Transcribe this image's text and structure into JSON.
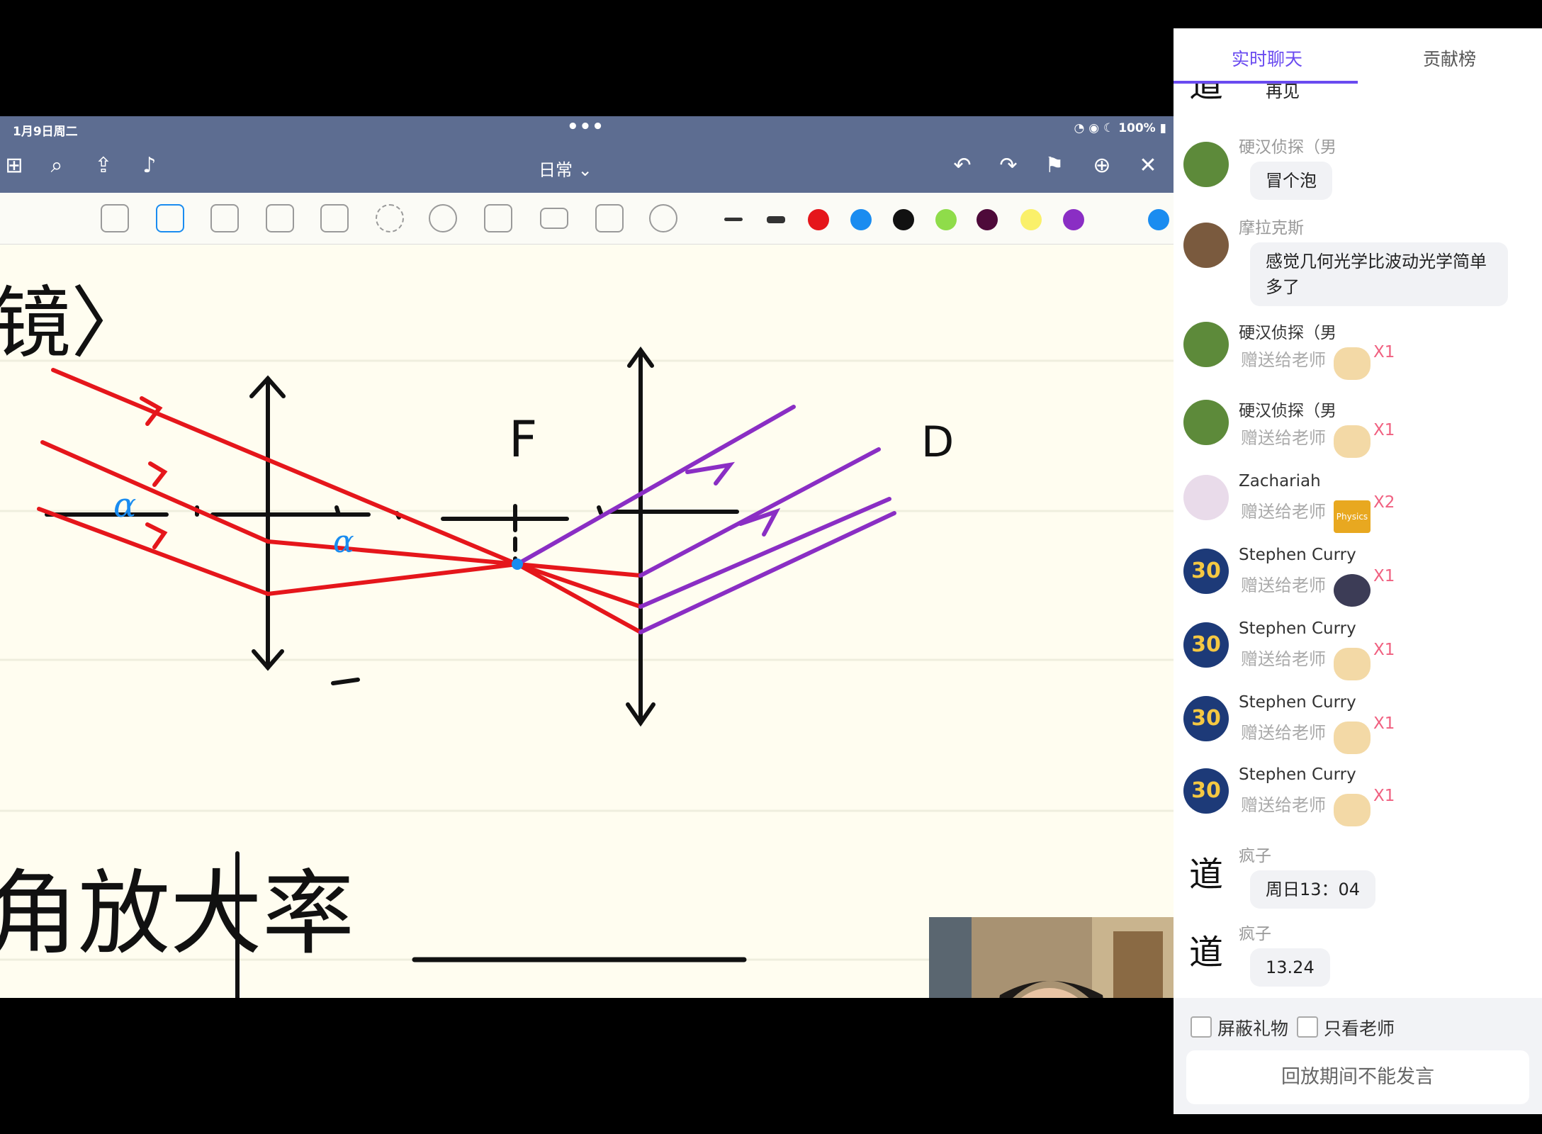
{
  "ipad": {
    "status_date": "1月9日周二",
    "status_dots": "•••",
    "status_right": "100%",
    "doc_title": "日常 ⌄"
  },
  "icons": {
    "grid": "grid-icon",
    "search": "search-icon",
    "share": "share-icon",
    "mic": "microphone-icon",
    "undo": "undo-icon",
    "redo": "redo-icon",
    "bookmark": "bookmark-icon",
    "add_page": "add-page-icon",
    "close": "close-icon"
  },
  "pen_colors": [
    "#e5161b",
    "#1a8cf0",
    "#111111",
    "#8fdc4a",
    "#4e0a3a",
    "#faf06a",
    "#8a2ec4",
    "#1a8cf0"
  ],
  "board": {
    "heading_partial": "镜〉",
    "label_F": "F",
    "label_D": "D",
    "label_alpha1": "α",
    "label_alpha2": "α",
    "bottom_text": "角放大率",
    "bottom_dash": "—"
  },
  "chat": {
    "tabs": [
      "实时聊天",
      "贡献榜"
    ],
    "messages": [
      {
        "type": "text",
        "name": "",
        "text": "再见"
      },
      {
        "type": "text",
        "name": "硬汉侦探（男",
        "text": "冒个泡"
      },
      {
        "type": "text",
        "name": "摩拉克斯",
        "text": "感觉几何光学比波动光学简单多了"
      },
      {
        "type": "gift",
        "name": "硬汉侦探（男",
        "text": "赠送给老师",
        "count": "X1"
      },
      {
        "type": "gift",
        "name": "硬汉侦探（男",
        "text": "赠送给老师",
        "count": "X1"
      },
      {
        "type": "gift",
        "name": "Zachariah",
        "text": "赠送给老师",
        "count": "X2",
        "gift_label": "Physics"
      },
      {
        "type": "gift",
        "name": "Stephen Curry",
        "text": "赠送给老师",
        "count": "X1"
      },
      {
        "type": "gift",
        "name": "Stephen Curry",
        "text": "赠送给老师",
        "count": "X1"
      },
      {
        "type": "gift",
        "name": "Stephen Curry",
        "text": "赠送给老师",
        "count": "X1"
      },
      {
        "type": "gift",
        "name": "Stephen Curry",
        "text": "赠送给老师",
        "count": "X1"
      },
      {
        "type": "text",
        "name": "疯子",
        "text": "周日13：04"
      },
      {
        "type": "text",
        "name": "疯子",
        "text": "13.24"
      }
    ],
    "avatar_number": "30",
    "checkbox_hide_gifts": "屏蔽礼物",
    "checkbox_teacher_only": "只看老师",
    "input_placeholder": "回放期间不能发言"
  }
}
